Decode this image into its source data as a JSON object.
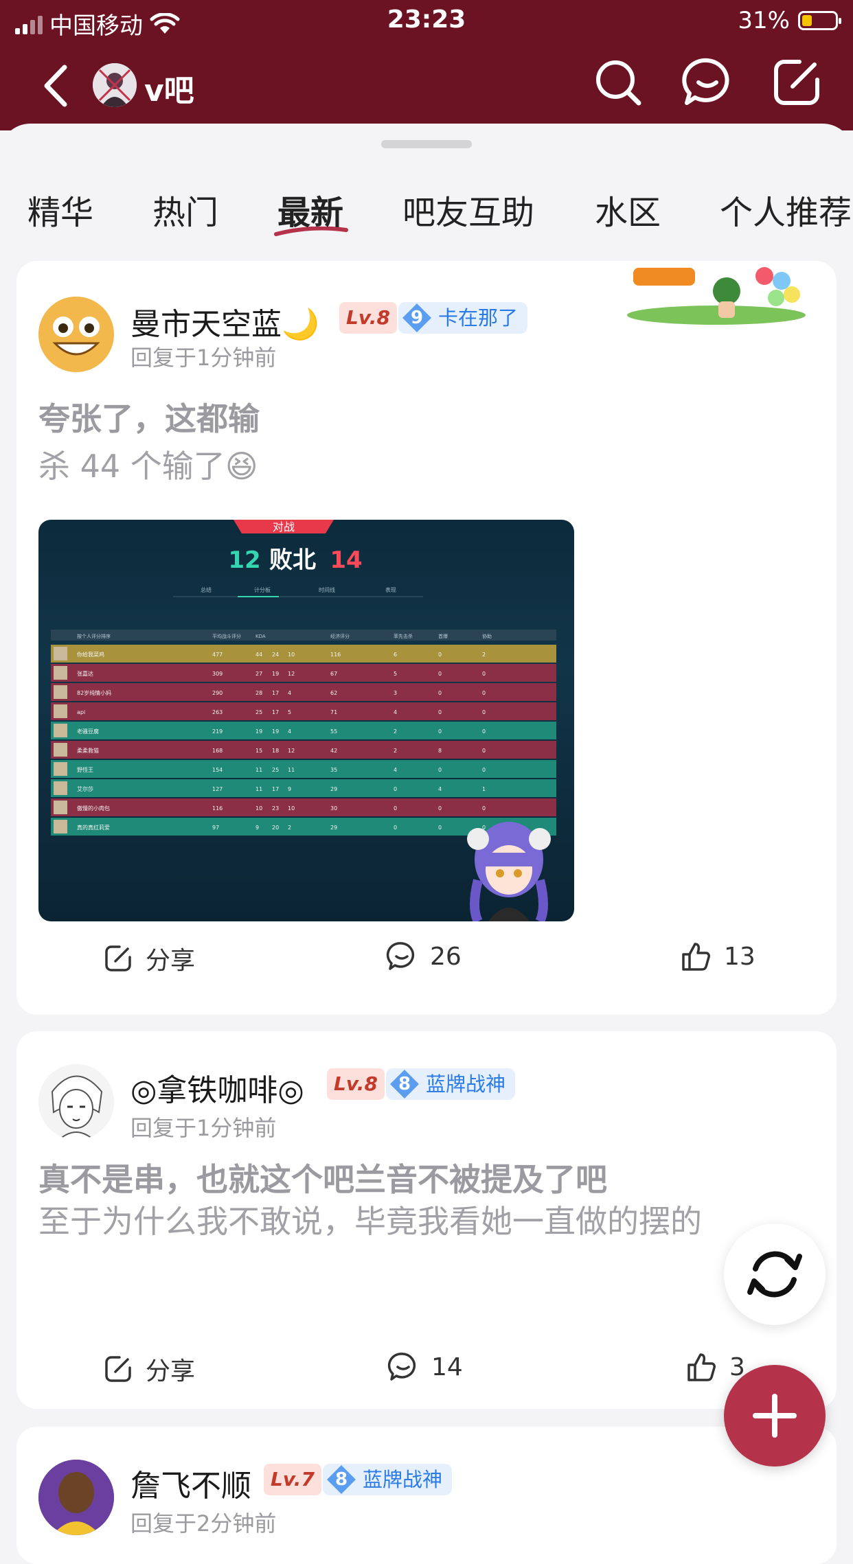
{
  "status": {
    "carrier": "中国移动",
    "time": "23:23",
    "battery": "31%"
  },
  "nav": {
    "forum_name": "v吧"
  },
  "tabs": [
    {
      "label": "精华"
    },
    {
      "label": "热门"
    },
    {
      "label": "最新",
      "active": true
    },
    {
      "label": "吧友互助"
    },
    {
      "label": "水区"
    },
    {
      "label": "个人推荐"
    }
  ],
  "posts": [
    {
      "user": "曼市天空蓝🌙",
      "level": "Lv.8",
      "tag_num": "9",
      "tag": "卡在那了",
      "time": "回复于1分钟前",
      "title": "夸张了，这都输",
      "body": "杀 44 个输了😆",
      "share": "分享",
      "comments": "26",
      "likes": "13",
      "image": {
        "tab_label": "对战",
        "score_left": "12",
        "result": "败北",
        "score_right": "14",
        "subtabs": [
          "总结",
          "计分板",
          "时间线",
          "表现"
        ],
        "header": [
          "按个人评分排序",
          "平均战斗评分",
          "KDA",
          "",
          "",
          "经济评分",
          "率先击杀",
          "首爆",
          "协助"
        ],
        "rows": [
          {
            "name": "你给我菜鸡",
            "acs": "477",
            "k": "44",
            "d": "24",
            "a": "10",
            "econ": "116",
            "fb": "6",
            "plant": "0",
            "def": "2",
            "team": "gold"
          },
          {
            "name": "张嘉达",
            "acs": "309",
            "k": "27",
            "d": "19",
            "a": "12",
            "econ": "67",
            "fb": "5",
            "plant": "0",
            "def": "0",
            "team": "red"
          },
          {
            "name": "82岁纯情小妈",
            "acs": "290",
            "k": "28",
            "d": "17",
            "a": "4",
            "econ": "62",
            "fb": "3",
            "plant": "0",
            "def": "0",
            "team": "red"
          },
          {
            "name": "api",
            "acs": "263",
            "k": "25",
            "d": "17",
            "a": "5",
            "econ": "71",
            "fb": "4",
            "plant": "0",
            "def": "0",
            "team": "red"
          },
          {
            "name": "老骚豆腐",
            "acs": "219",
            "k": "19",
            "d": "19",
            "a": "4",
            "econ": "55",
            "fb": "2",
            "plant": "0",
            "def": "0",
            "team": "green"
          },
          {
            "name": "柔柔救猫",
            "acs": "168",
            "k": "15",
            "d": "18",
            "a": "12",
            "econ": "42",
            "fb": "2",
            "plant": "8",
            "def": "0",
            "team": "red"
          },
          {
            "name": "野怪王",
            "acs": "154",
            "k": "11",
            "d": "25",
            "a": "11",
            "econ": "35",
            "fb": "4",
            "plant": "0",
            "def": "0",
            "team": "green"
          },
          {
            "name": "艾尔莎",
            "acs": "127",
            "k": "11",
            "d": "17",
            "a": "9",
            "econ": "29",
            "fb": "0",
            "plant": "4",
            "def": "1",
            "team": "green"
          },
          {
            "name": "傲慢的小肉包",
            "acs": "116",
            "k": "10",
            "d": "23",
            "a": "10",
            "econ": "30",
            "fb": "0",
            "plant": "0",
            "def": "0",
            "team": "red"
          },
          {
            "name": "真的真红莉爱",
            "acs": "97",
            "k": "9",
            "d": "20",
            "a": "2",
            "econ": "29",
            "fb": "0",
            "plant": "0",
            "def": "0",
            "team": "green"
          }
        ]
      }
    },
    {
      "user": "◎拿铁咖啡◎",
      "level": "Lv.8",
      "tag_num": "8",
      "tag": "蓝牌战神",
      "time": "回复于1分钟前",
      "title": "真不是串，也就这个吧兰音不被提及了吧",
      "body": "至于为什么我不敢说，毕竟我看她一直做的摆的",
      "share": "分享",
      "comments": "14",
      "likes": "3"
    },
    {
      "user": "詹飞不顺",
      "level": "Lv.7",
      "tag_num": "8",
      "tag": "蓝牌战神",
      "time": "回复于2分钟前"
    }
  ],
  "colors": {
    "header_bg": "#6b1322",
    "accent": "#b5334a",
    "tag_blue": "#2b7be6",
    "level_red": "#c23b2a"
  }
}
